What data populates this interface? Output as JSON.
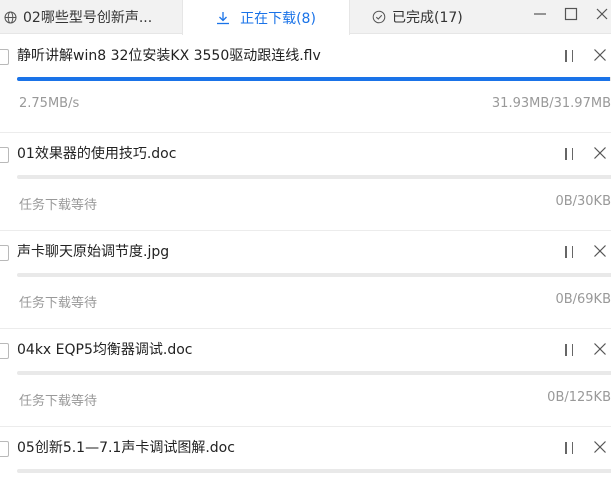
{
  "tabs": {
    "folder": {
      "label": "02哪些型号创新声...",
      "icon": "globe-icon"
    },
    "downloading": {
      "label": "正在下载(8)",
      "icon": "download-icon",
      "accent": "#1a73e8"
    },
    "completed": {
      "label": "已完成(17)",
      "icon": "check-circle-icon"
    }
  },
  "window_controls": {
    "minimize": "—",
    "maximize": "☐",
    "close": "✕"
  },
  "downloads": [
    {
      "name": "静听讲解win8 32位安装KX 3550驱动跟连线.flv",
      "status": "2.75MB/s",
      "size": "31.93MB/31.97MB",
      "progress": 0.999
    },
    {
      "name": "01效果器的使用技巧.doc",
      "status": "任务下载等待",
      "size": "0B/30KB",
      "progress": 0
    },
    {
      "name": "声卡聊天原始调节度.jpg",
      "status": "任务下载等待",
      "size": "0B/69KB",
      "progress": 0
    },
    {
      "name": "04kx EQP5均衡器调试.doc",
      "status": "任务下载等待",
      "size": "0B/125KB",
      "progress": 0
    },
    {
      "name": "05创新5.1—7.1声卡调试图解.doc",
      "status": "",
      "size": "",
      "progress": 0
    }
  ],
  "colors": {
    "accent": "#1a73e8",
    "track": "#e9e9e9",
    "muted": "#999999"
  }
}
